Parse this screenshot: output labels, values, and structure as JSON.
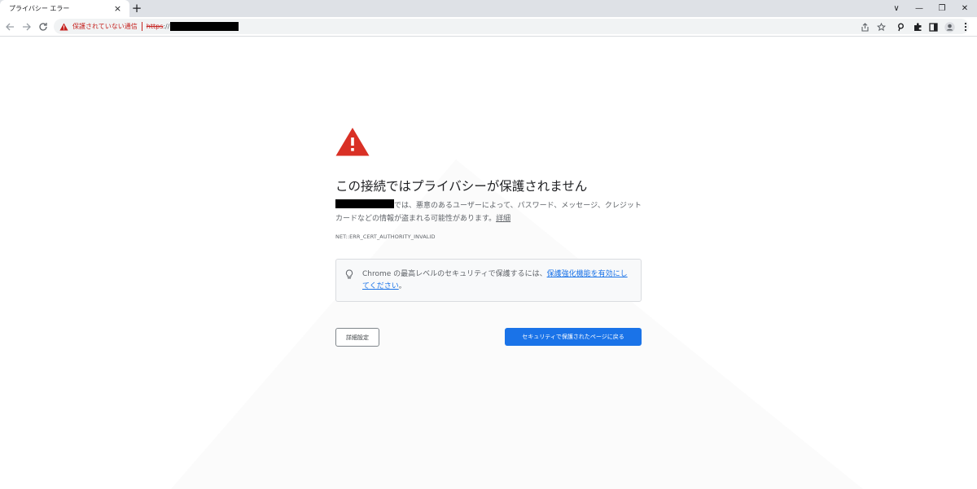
{
  "tab": {
    "title": "プライバシー エラー",
    "close": "×"
  },
  "new_tab": "+",
  "window": {
    "dropdown": "∨",
    "minimize": "—",
    "restore": "❐",
    "close": "✕"
  },
  "omnibox": {
    "security_label": "保護されていない通信",
    "scheme": "https",
    "scheme_rest": "://"
  },
  "page": {
    "heading": "この接続ではプライバシーが保護されません",
    "paragraph": "では、悪意のあるユーザーによって、パスワード、メッセージ、クレジットカードなどの情報が盗まれる可能性があります。",
    "details_link": "詳細",
    "error_code": "NET::ERR_CERT_AUTHORITY_INVALID",
    "info_text": "Chrome の最高レベルのセキュリティで保護するには、",
    "info_link": "保護強化機能を有効にしてください",
    "info_end": "。",
    "advanced_button": "詳細設定",
    "back_button": "セキュリティで保護されたページに戻る"
  },
  "colors": {
    "accent": "#1a73e8",
    "warning": "#d93025",
    "danger_text": "#c5221f"
  }
}
